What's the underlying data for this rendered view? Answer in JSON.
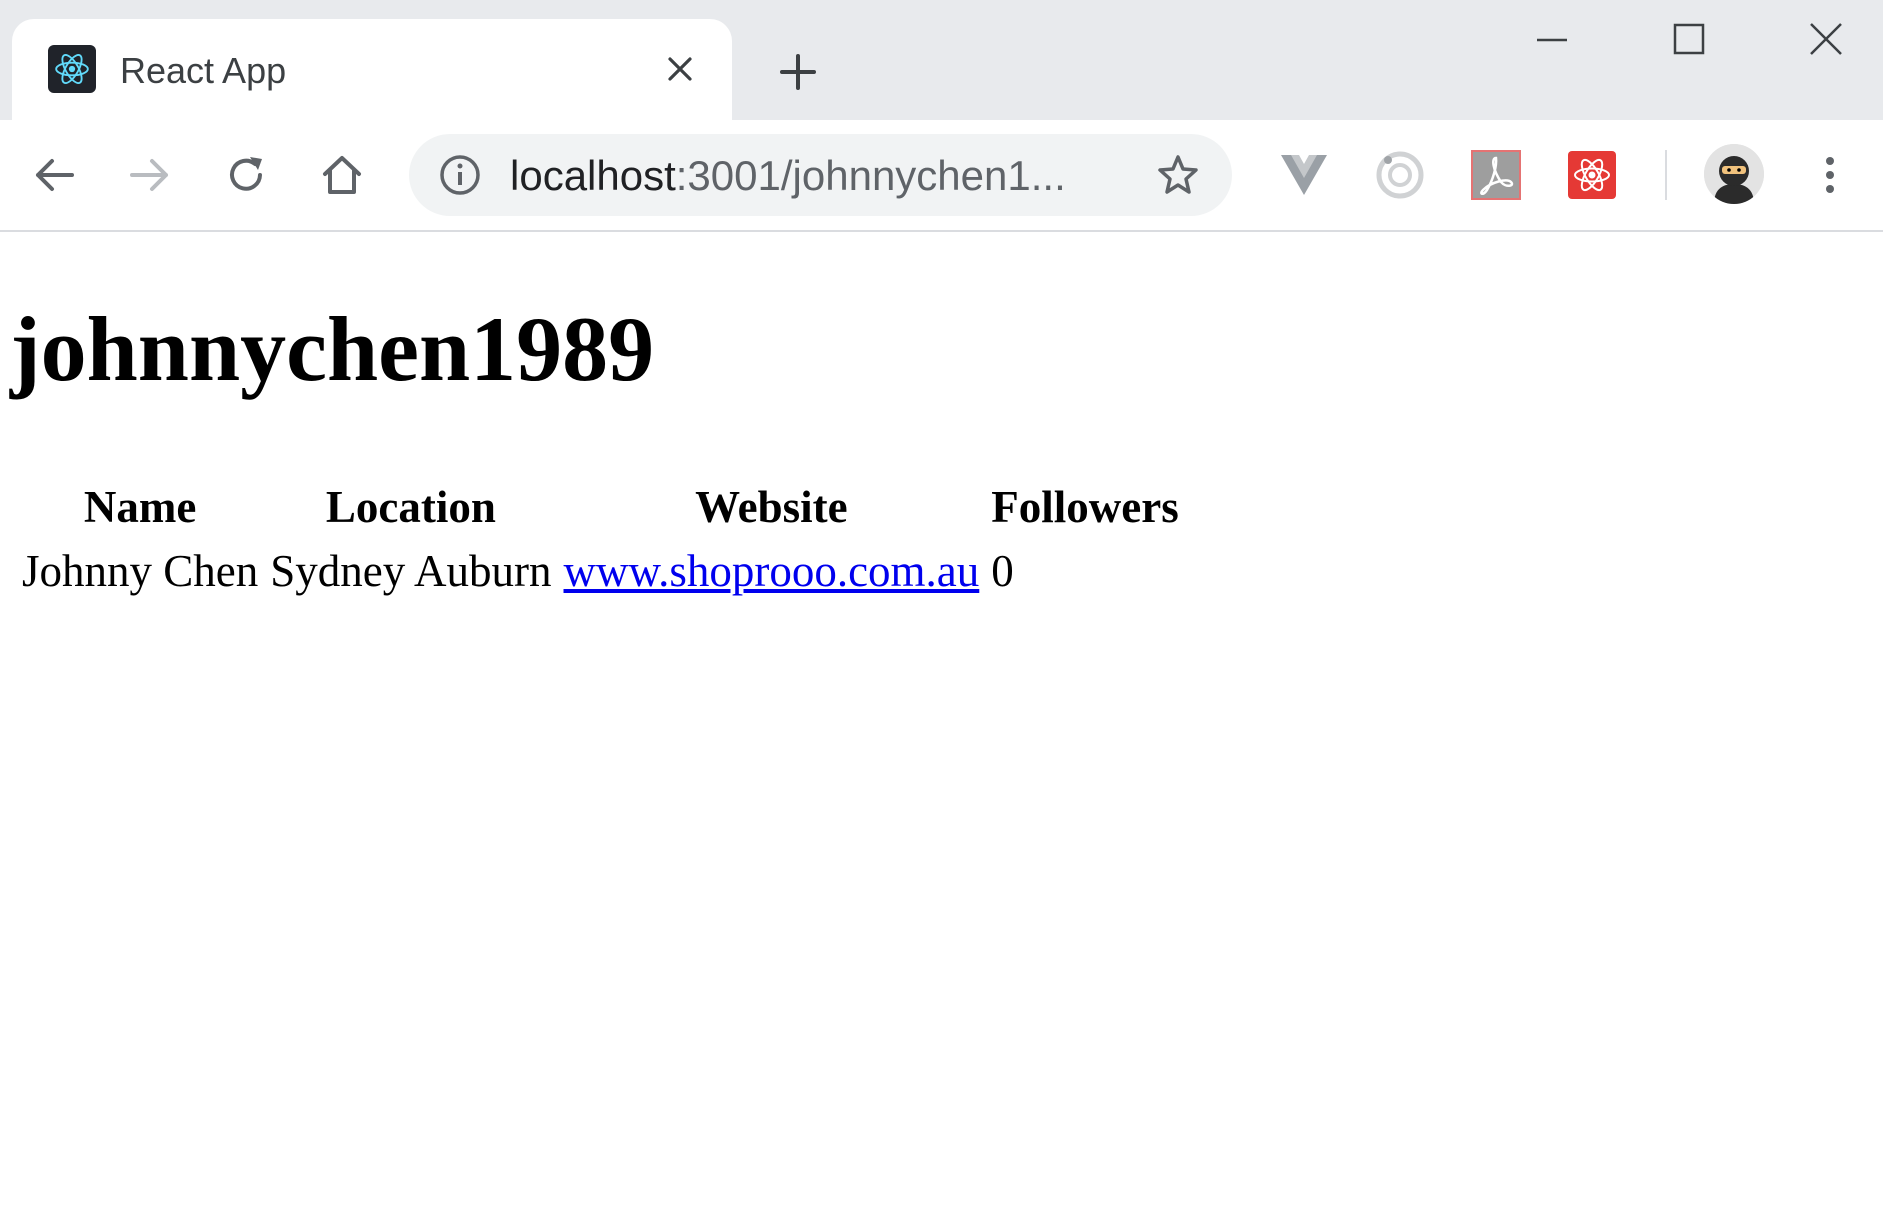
{
  "browser": {
    "tab": {
      "title": "React App",
      "favicon": "react-logo-icon"
    },
    "url": {
      "host": "localhost",
      "rest": ":3001/johnnychen1..."
    },
    "window_controls": [
      "minimize-icon",
      "maximize-icon",
      "close-icon"
    ],
    "extensions": [
      "vue-devtools-icon",
      "circle-extension-icon",
      "pdf-extension-icon",
      "react-devtools-icon"
    ],
    "colors": {
      "tabstrip": "#e8eaed",
      "omnibox": "#f1f3f4",
      "link": "#0000ee"
    }
  },
  "page": {
    "title": "johnnychen1989",
    "table": {
      "headers": [
        "Name",
        "Location",
        "Website",
        "Followers"
      ],
      "rows": [
        {
          "name": "Johnny Chen",
          "location": "Sydney Auburn",
          "website": "www.shoprooo.com.au",
          "followers": "0"
        }
      ]
    }
  }
}
